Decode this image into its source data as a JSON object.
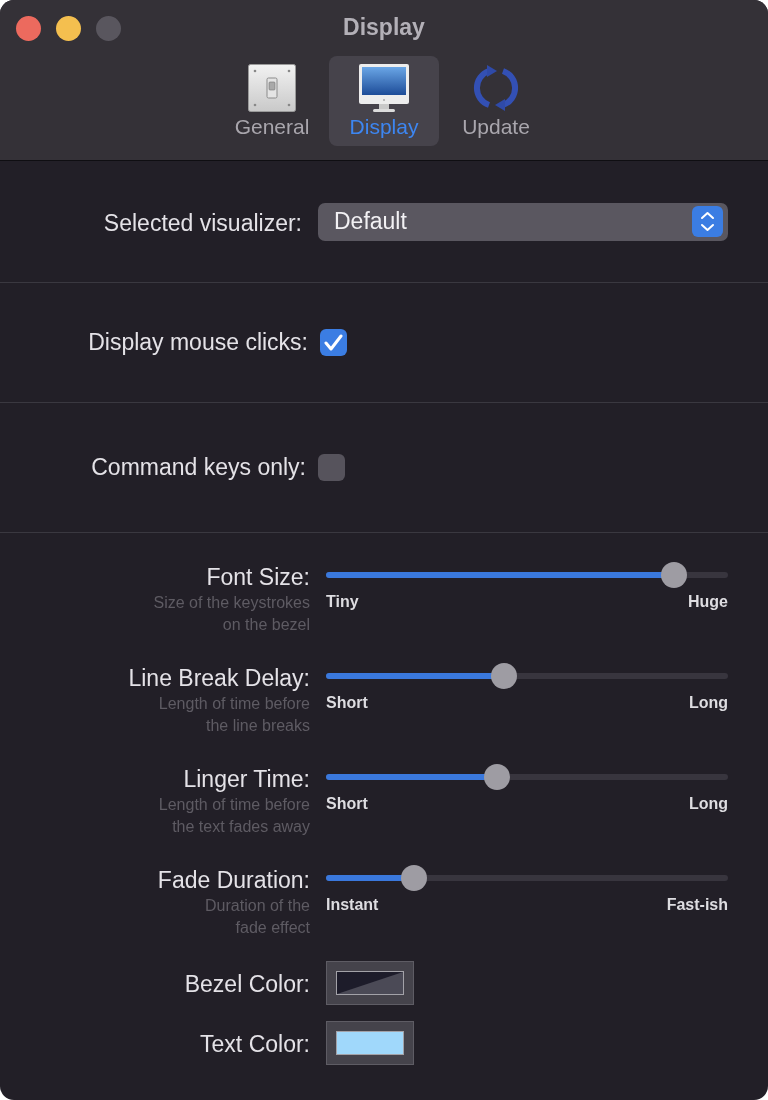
{
  "window": {
    "title": "Display",
    "traffic_lights": [
      {
        "kind": "close",
        "disabled": false
      },
      {
        "kind": "minimize",
        "disabled": false
      },
      {
        "kind": "zoom",
        "disabled": true
      }
    ]
  },
  "toolbar": {
    "tabs": [
      {
        "kind": "switch",
        "label": "General",
        "selected": false
      },
      {
        "kind": "monitor",
        "label": "Display",
        "selected": true
      },
      {
        "kind": "refresh",
        "label": "Update",
        "selected": false
      }
    ]
  },
  "sections": [
    {
      "kind": "popup",
      "label": "Selected visualizer:",
      "value": "Default"
    },
    {
      "kind": "checkbox",
      "label": "Display mouse clicks:",
      "checked": true
    },
    {
      "kind": "checkbox",
      "label": "Command keys only:",
      "checked": false
    }
  ],
  "sliders": [
    {
      "label": "Font Size:",
      "description": "Size of the keystrokes\non the bezel",
      "level": 0.89,
      "min_label": "Tiny",
      "max_label": "Huge"
    },
    {
      "label": "Line Break Delay:",
      "description": "Length of time before\nthe line breaks",
      "level": 0.44,
      "min_label": "Short",
      "max_label": "Long"
    },
    {
      "label": "Linger Time:",
      "description": "Length of time before\nthe text fades away",
      "level": 0.42,
      "min_label": "Short",
      "max_label": "Long"
    },
    {
      "label": "Fade Duration:",
      "description": "Duration of the\nfade effect",
      "level": 0.2,
      "min_label": "Instant",
      "max_label": "Fast-ish"
    }
  ],
  "colors": [
    {
      "label": "Bezel Color:",
      "color": "#1d1c2a",
      "translucent": true
    },
    {
      "label": "Text Color:",
      "color": "#a0d8fb",
      "translucent": false
    }
  ]
}
